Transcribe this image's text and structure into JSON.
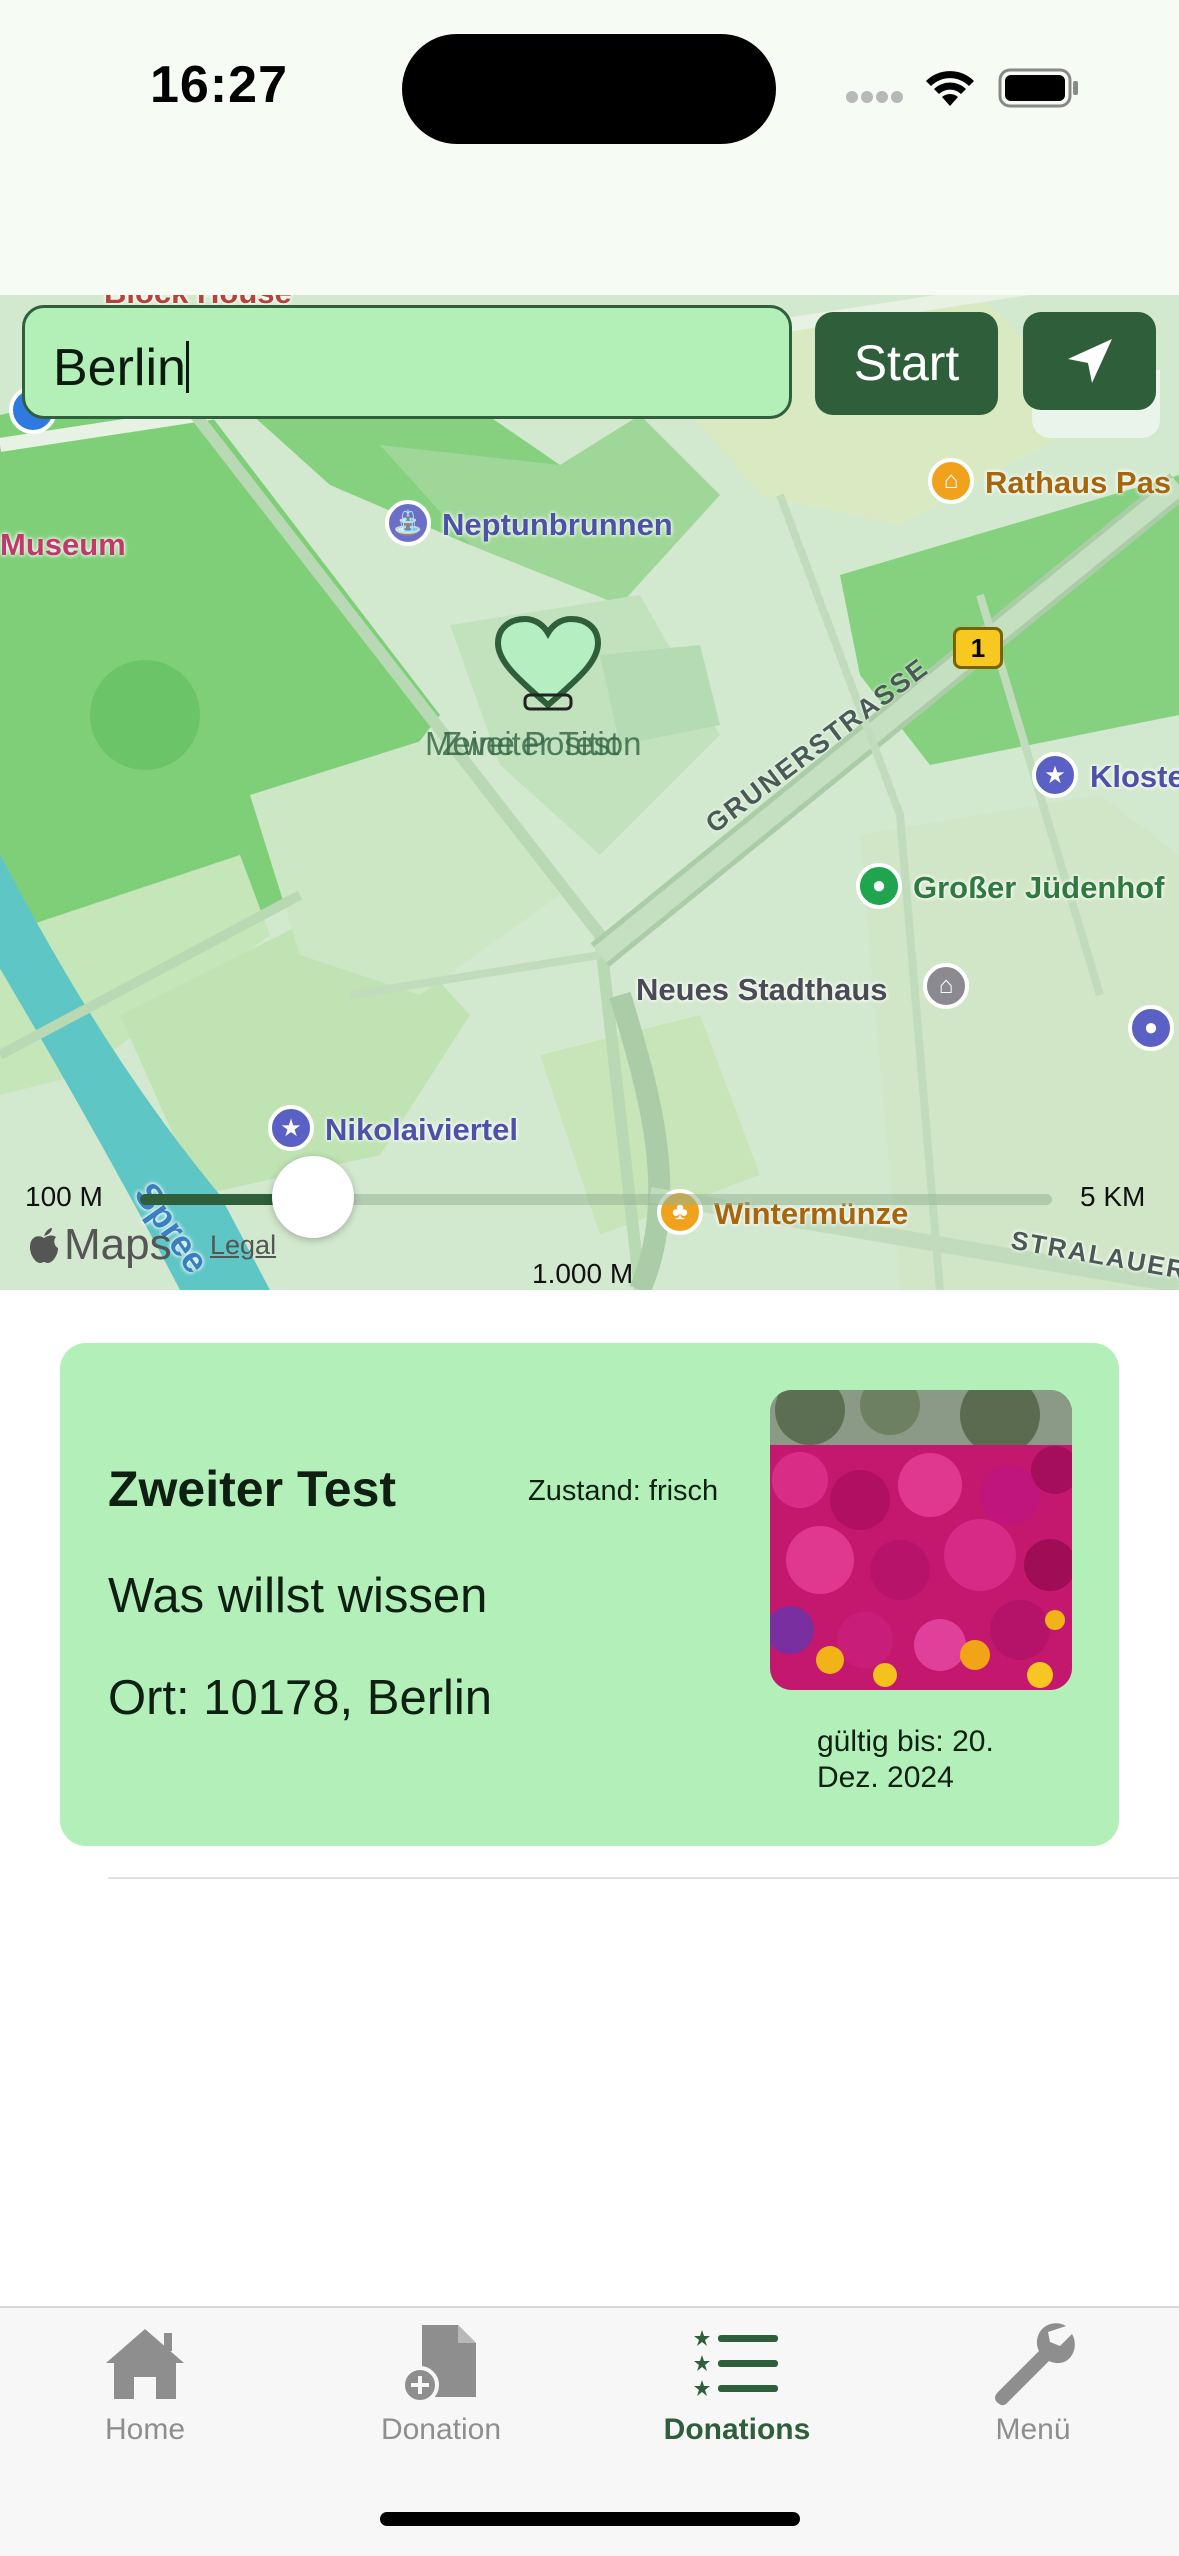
{
  "status_bar": {
    "time": "16:27"
  },
  "search": {
    "value": "Berlin"
  },
  "buttons": {
    "start": "Start"
  },
  "map": {
    "labels": {
      "block_house": "Block House",
      "museum": "Museum",
      "neptunbrunnen": "Neptunbrunnen",
      "rathaus": "Rathaus Pas",
      "route_badge": "1",
      "kloster": "Kloste",
      "grunerstrasse": "GRUNERSTRASSE",
      "grosser_juedenhof": "Großer Jüdenhof",
      "neues_stadthaus": "Neues Stadthaus",
      "nikolaiviertel": "Nikolaiviertel",
      "wintermuenze": "Wintermünze",
      "stralauer": "STRALAUER",
      "spree": "Spree",
      "marker_label_1": "Meine Position",
      "marker_label_2": "Zweiter Test",
      "maps_brand": "Maps",
      "legal": "Legal"
    },
    "slider": {
      "min_label": "100 M",
      "max_label": "5 KM",
      "current_label": "1.000 M",
      "value_fraction": 0.19
    }
  },
  "donation_card": {
    "title": "Zweiter Test",
    "state": "Zustand: frisch",
    "description": "Was willst wissen",
    "place": "Ort: 10178, Berlin",
    "valid_until": "gültig bis: 20. Dez. 2024"
  },
  "tab_bar": {
    "active": "Donations",
    "items": [
      {
        "label": "Home",
        "icon": "house-icon"
      },
      {
        "label": "Donation",
        "icon": "document-add-icon"
      },
      {
        "label": "Donations",
        "icon": "list-icon"
      },
      {
        "label": "Menü",
        "icon": "wrench-icon"
      }
    ]
  },
  "colors": {
    "accent": "#2e5e3a",
    "card": "#b3f0b9",
    "active_tab": "#2e5e3a",
    "inactive_tab": "#8e8e8e"
  }
}
